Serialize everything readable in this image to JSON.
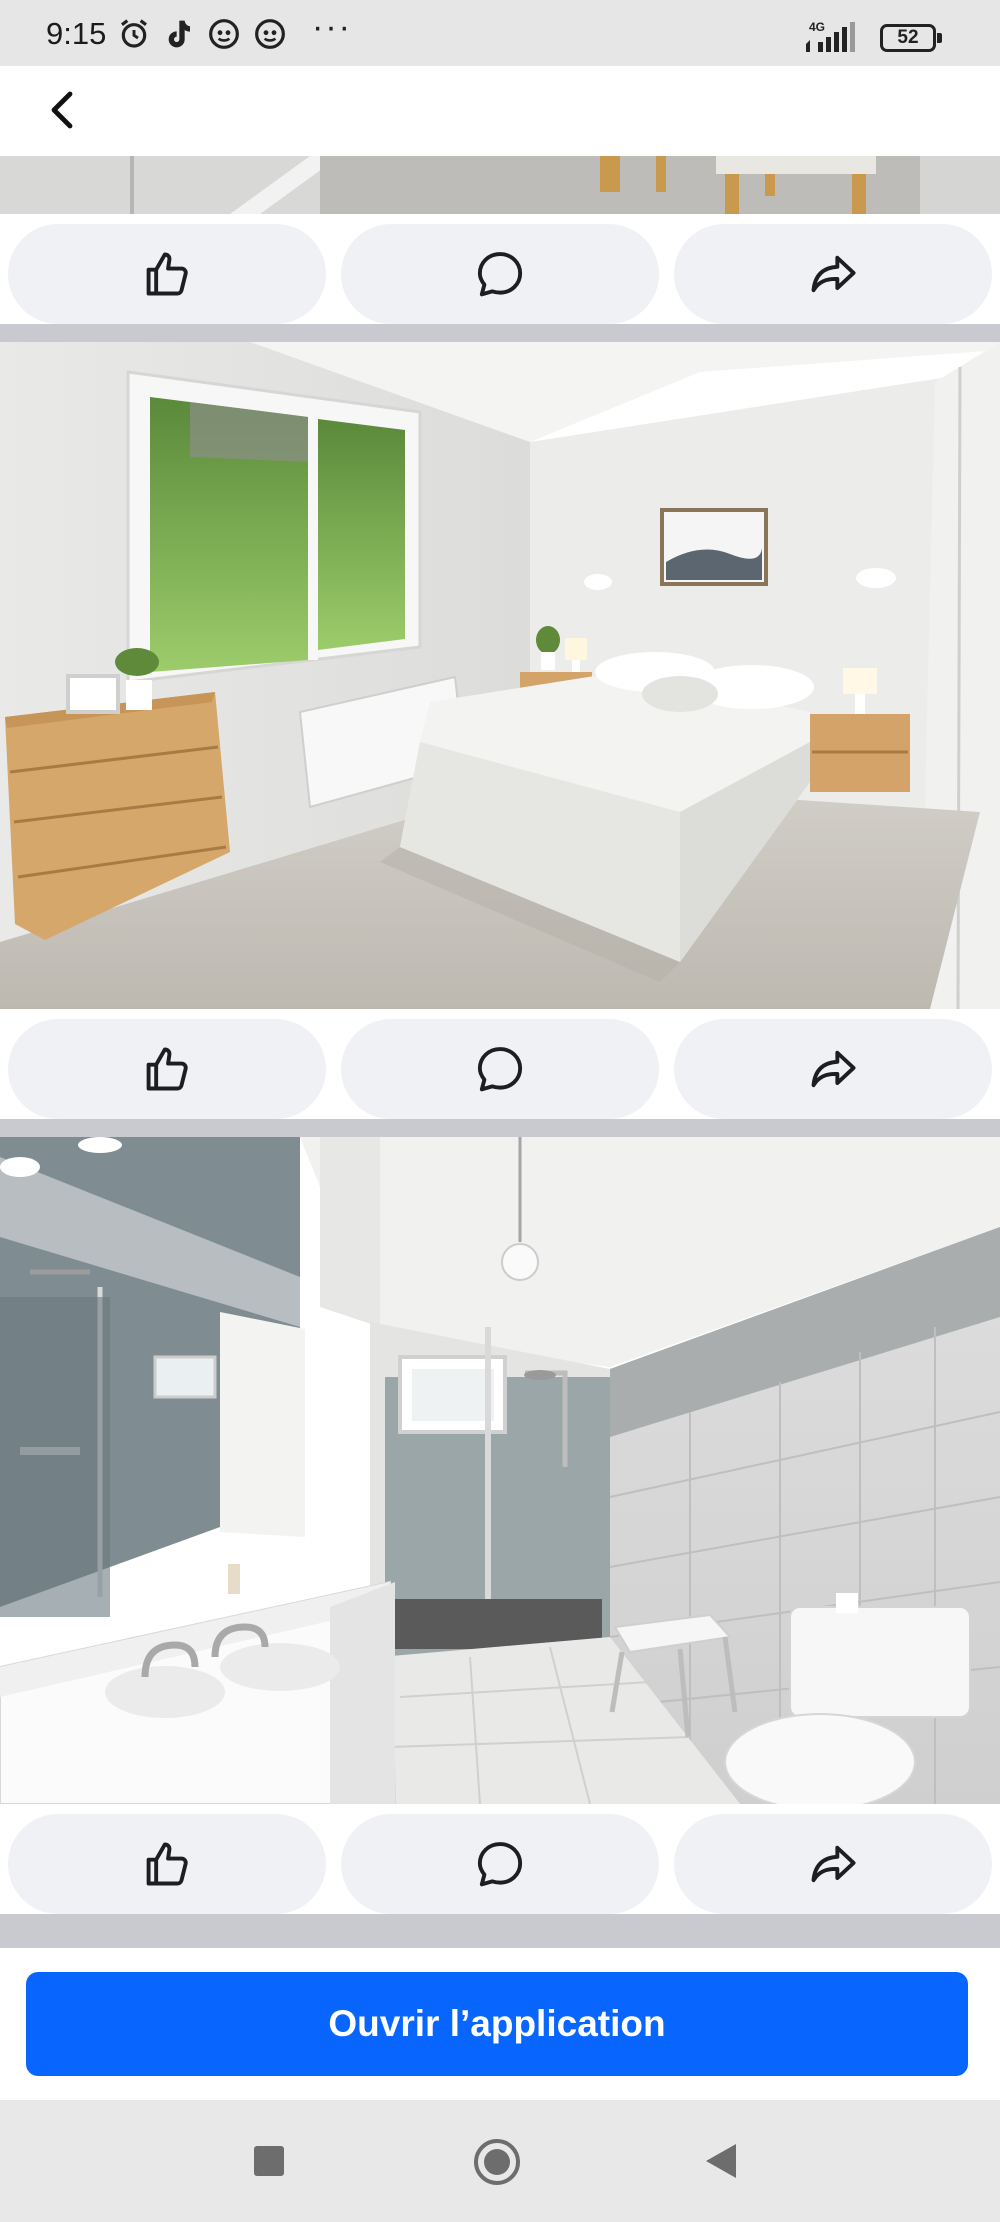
{
  "status_bar": {
    "time": "9:15",
    "more": "···",
    "network": "4G",
    "battery": "52",
    "icons": [
      "alarm-icon",
      "tiktok-icon",
      "app-face-icon",
      "app-face-icon",
      "signal-icon",
      "battery-icon"
    ]
  },
  "top_nav": {
    "back_icon": "chevron-left-icon"
  },
  "posts": [
    {
      "photo": "kitchen-photo-partial",
      "actions": [
        "like-icon",
        "comment-icon",
        "share-icon"
      ]
    },
    {
      "photo": "bedroom-photo",
      "actions": [
        "like-icon",
        "comment-icon",
        "share-icon"
      ]
    },
    {
      "photo": "bathroom-photo",
      "actions": [
        "like-icon",
        "comment-icon",
        "share-icon"
      ]
    }
  ],
  "cta": {
    "label": "Ouvrir l’application",
    "color": "#0866ff"
  },
  "colors": {
    "action_button_bg": "#f0f1f4",
    "divider": "#c8cacf",
    "status_bar_bg": "#e6e6e6"
  }
}
